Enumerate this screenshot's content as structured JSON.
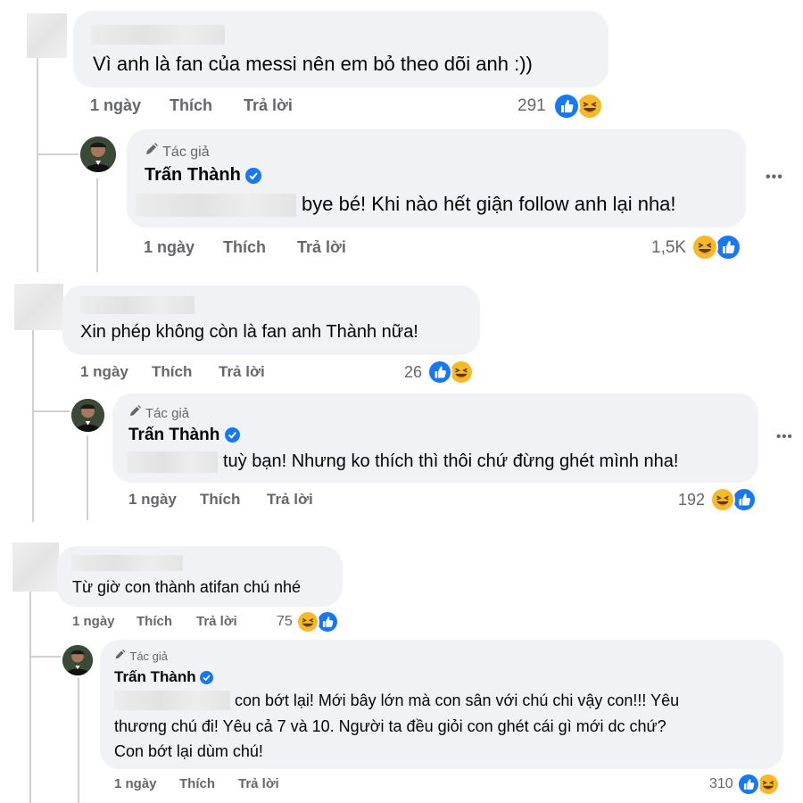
{
  "actions": {
    "time": "1 ngày",
    "like": "Thích",
    "reply": "Trả lời"
  },
  "author": {
    "tag": "Tác giả",
    "name": "Trấn Thành"
  },
  "threads": [
    {
      "comment": {
        "text": "Vì anh là fan của messi nên em bỏ theo dõi anh :))",
        "count": "291"
      },
      "reply": {
        "text": "bye bé! Khi nào hết giận follow anh lại nha!",
        "count": "1,5K"
      }
    },
    {
      "comment": {
        "text": "Xin phép không còn là fan anh Thành nữa!",
        "count": "26"
      },
      "reply": {
        "text": "tuỳ bạn! Nhưng ko thích thì thôi chứ đừng ghét mình nha!",
        "count": "192"
      }
    },
    {
      "comment": {
        "text": "Từ giờ con thành atifan chú nhé",
        "count": "75"
      },
      "reply": {
        "line1": "con bớt lại! Mới bây lớn mà con sân với chú chi vậy con!!! Yêu",
        "line2": "thương chú đi! Yêu cả 7 và 10. Người ta đều giỏi con ghét cái gì mới dc chứ?",
        "line3": "Con bớt lại dùm chú!",
        "count": "310"
      }
    }
  ],
  "more_label": "•••",
  "colors": {
    "bubble": "#f0f2f5",
    "meta": "#65676b",
    "like": "#1877f2",
    "haha": "#f7b928",
    "thread_line": "#ced0d4"
  }
}
